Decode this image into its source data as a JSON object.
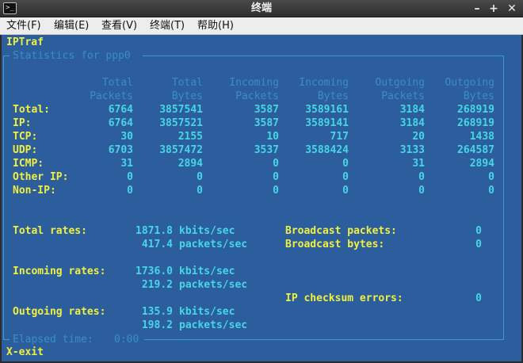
{
  "window": {
    "title": "终端",
    "app_icon": "terminal-icon",
    "buttons": [
      "minimize",
      "maximize",
      "close"
    ],
    "minimize_glyph": "–",
    "maximize_glyph": "+",
    "close_glyph": "✕"
  },
  "menubar": {
    "items": [
      "文件(F)",
      "编辑(E)",
      "查看(V)",
      "终端(T)",
      "帮助(H)"
    ]
  },
  "terminal": {
    "app_name": "IPTraf",
    "box_title": "Statistics for ppp0",
    "columns": [
      {
        "line1": "Total",
        "line2": "Packets"
      },
      {
        "line1": "Total",
        "line2": "Bytes"
      },
      {
        "line1": "Incoming",
        "line2": "Packets"
      },
      {
        "line1": "Incoming",
        "line2": "Bytes"
      },
      {
        "line1": "Outgoing",
        "line2": "Packets"
      },
      {
        "line1": "Outgoing",
        "line2": "Bytes"
      }
    ],
    "rows": [
      {
        "label": "Total:",
        "values": [
          "6764",
          "3857541",
          "3587",
          "3589161",
          "3184",
          "268919"
        ]
      },
      {
        "label": "IP:",
        "values": [
          "6764",
          "3857521",
          "3587",
          "3589141",
          "3184",
          "268919"
        ]
      },
      {
        "label": "TCP:",
        "values": [
          "30",
          "2155",
          "10",
          "717",
          "20",
          "1438"
        ]
      },
      {
        "label": "UDP:",
        "values": [
          "6703",
          "3857472",
          "3537",
          "3588424",
          "3133",
          "264587"
        ]
      },
      {
        "label": "ICMP:",
        "values": [
          "31",
          "2894",
          "0",
          "0",
          "31",
          "2894"
        ]
      },
      {
        "label": "Other IP:",
        "values": [
          "0",
          "0",
          "0",
          "0",
          "0",
          "0"
        ]
      },
      {
        "label": "Non-IP:",
        "values": [
          "0",
          "0",
          "0",
          "0",
          "0",
          "0"
        ]
      }
    ],
    "rates": {
      "total_label": "Total rates:",
      "total_kbits": "1871.8",
      "total_packets": "417.4",
      "incoming_label": "Incoming rates:",
      "incoming_kbits": "1736.0",
      "incoming_packets": "219.2",
      "outgoing_label": "Outgoing rates:",
      "outgoing_kbits": "135.9",
      "outgoing_packets": "198.2",
      "kbits_unit": "kbits/sec",
      "packets_unit": "packets/sec"
    },
    "broadcast": {
      "packets_label": "Broadcast packets:",
      "packets_value": "0",
      "bytes_label": "Broadcast bytes:",
      "bytes_value": "0",
      "checksum_label": "IP checksum errors:",
      "checksum_value": "0"
    },
    "elapsed_label": "Elapsed time:",
    "elapsed_value": "0:00",
    "footer": "X-exit"
  },
  "colors": {
    "terminal_bg": "#2c5e9e",
    "label_yellow": "#f0f040",
    "value_cyan": "#46d6e6",
    "dim_header": "#3a8ec0"
  }
}
